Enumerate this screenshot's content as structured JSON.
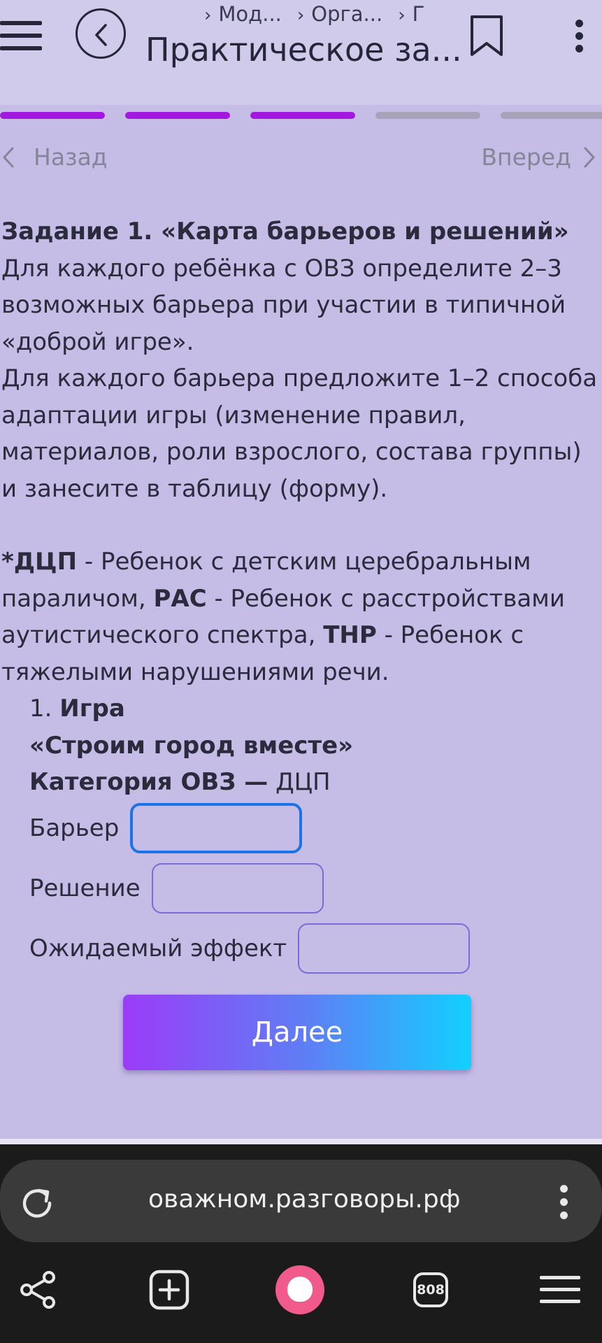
{
  "header": {
    "breadcrumbs": [
      "Мод...",
      "Орга...",
      "Г"
    ],
    "title": "Практическое за..."
  },
  "progress": {
    "steps_total": 5,
    "steps_done": 3,
    "active_color": "#a318df",
    "inactive_color": "#a7a3b8"
  },
  "nav": {
    "back_label": "Назад",
    "forward_label": "Вперед"
  },
  "task": {
    "heading": "Задание 1. «Карта барьеров и решений»",
    "para1": "Для каждого ребёнка с ОВЗ определите 2–3 возможных барьера при участии в типичной «доброй игре».",
    "para2": "Для каждого барьера предложите 1–2 способа адаптации игры (изменение правил, материалов, роли взрослого, состава группы) и занесите в таблицу (форму).",
    "legend": {
      "dcp_abbr": "*ДЦП",
      "dcp_text": " - Ребенок с детским церебральным параличом, ",
      "ras_abbr": "РАС",
      "ras_text": " - Ребенок с расстройствами аутистического спектра, ",
      "tnr_abbr": "ТНР",
      "tnr_text": " - Ребенок с тяжелыми нарушениями речи."
    },
    "item_number": "1.",
    "item_game_label": "Игра",
    "item_game_name": "«Строим город вместе»",
    "item_category_label": "Категория ОВЗ —",
    "item_category_value": " ДЦП"
  },
  "form": {
    "barrier_label": "Барьер",
    "barrier_value": "",
    "solution_label": "Решение",
    "solution_value": "",
    "effect_label": "Ожидаемый эффект",
    "effect_value": ""
  },
  "next_button_label": "Далее",
  "browser": {
    "url": "оважном.разговоры.рф",
    "tabs_count": "808"
  },
  "icons": {
    "menu": "hamburger-icon",
    "back": "chevron-left-circle-icon",
    "bookmark": "bookmark-icon",
    "more": "kebab-icon",
    "reload": "reload-icon",
    "share": "share-icon",
    "new_tab": "plus-square-icon",
    "assistant": "alice-icon",
    "tabs": "tabs-icon",
    "browser_menu": "menu-icon"
  },
  "colors": {
    "page_bg": "#c5bde6",
    "header_bg": "#d0cbea",
    "button_gradient_start": "#9b3cf7",
    "button_gradient_end": "#12d0ff",
    "focus_border": "#1a73e8"
  }
}
